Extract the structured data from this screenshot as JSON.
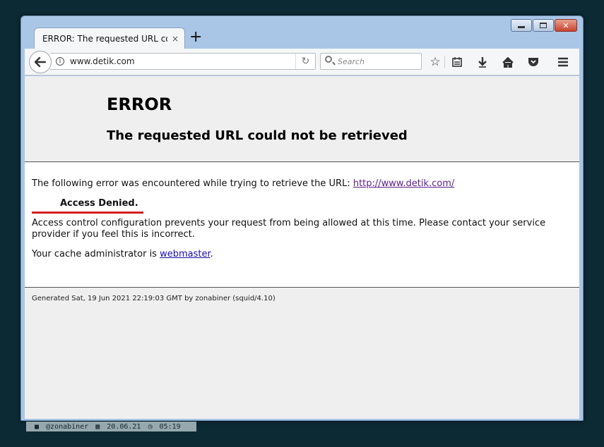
{
  "browser": {
    "tab_title": "ERROR: The requested URL could",
    "tab_close": "×",
    "new_tab": "+",
    "url": "www.detik.com",
    "search_placeholder": "Search",
    "caption": {
      "minimize": "",
      "maximize": "",
      "close": "✕"
    },
    "toolbar_icons": [
      "star-icon",
      "reading-list-icon",
      "download-icon",
      "home-icon",
      "pocket-icon",
      "menu-icon"
    ]
  },
  "page": {
    "title": "ERROR",
    "subtitle": "The requested URL could not be retrieved",
    "line1_prefix": "The following error was encountered while trying to retrieve the URL:",
    "line1_link": "http://www.detik.com/",
    "denied": "Access Denied.",
    "line3": "Access control configuration prevents your request from being allowed at this time. Please contact your service provider if you feel this is incorrect.",
    "line4_prefix": "Your cache administrator is",
    "line4_link": "webmaster",
    "line4_suffix": ".",
    "footer": "Generated Sat, 19 Jun 2021 22:19:03 GMT by zonabiner (squid/4.10)"
  },
  "statusbar": {
    "handle": "@zonabiner",
    "date": "20.06.21",
    "time": "05:19"
  },
  "colors": {
    "accent_red": "#d42020",
    "visited_link": "#5b1e8a",
    "link": "#1a0dab"
  }
}
